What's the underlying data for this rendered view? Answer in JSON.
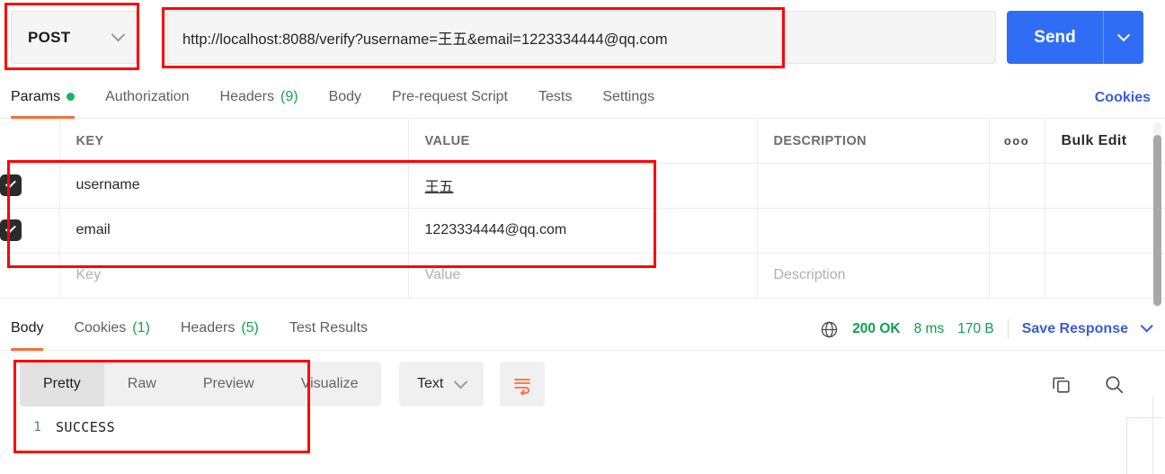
{
  "request": {
    "method": "POST",
    "method_caret_icon": "chevron-down-icon",
    "url": "http://localhost:8088/verify?username=王五&email=1223334444@qq.com",
    "send_label": "Send",
    "send_caret_icon": "chevron-down-icon"
  },
  "request_tabs": [
    {
      "label": "Params",
      "badge": "",
      "dot": true,
      "active": true
    },
    {
      "label": "Authorization",
      "badge": "",
      "dot": false,
      "active": false
    },
    {
      "label": "Headers",
      "badge": "(9)",
      "dot": false,
      "active": false
    },
    {
      "label": "Body",
      "badge": "",
      "dot": false,
      "active": false
    },
    {
      "label": "Pre-request Script",
      "badge": "",
      "dot": false,
      "active": false
    },
    {
      "label": "Tests",
      "badge": "",
      "dot": false,
      "active": false
    },
    {
      "label": "Settings",
      "badge": "",
      "dot": false,
      "active": false
    }
  ],
  "cookies_link": "Cookies",
  "params_table": {
    "headers": {
      "key": "KEY",
      "value": "VALUE",
      "description": "DESCRIPTION",
      "more_icon": "ooo",
      "bulk_edit": "Bulk Edit"
    },
    "rows": [
      {
        "checked": true,
        "key": "username",
        "value": "王五",
        "description": "",
        "value_underline": true
      },
      {
        "checked": true,
        "key": "email",
        "value": "1223334444@qq.com",
        "description": "",
        "value_underline": false
      }
    ],
    "placeholder_row": {
      "key": "Key",
      "value": "Value",
      "description": "Description"
    }
  },
  "response_tabs": [
    {
      "label": "Body",
      "badge": "",
      "active": true
    },
    {
      "label": "Cookies",
      "badge": "(1)",
      "active": false
    },
    {
      "label": "Headers",
      "badge": "(5)",
      "active": false
    },
    {
      "label": "Test Results",
      "badge": "",
      "active": false
    }
  ],
  "status": {
    "globe_icon": "globe-icon",
    "code": "200 OK",
    "time": "8 ms",
    "size": "170 B",
    "save_response": "Save Response",
    "save_caret_icon": "chevron-down-icon"
  },
  "viewer": {
    "modes": [
      {
        "label": "Pretty",
        "active": true
      },
      {
        "label": "Raw",
        "active": false
      },
      {
        "label": "Preview",
        "active": false
      },
      {
        "label": "Visualize",
        "active": false
      }
    ],
    "format": "Text",
    "format_caret_icon": "chevron-down-icon",
    "wrap_icon": "word-wrap-icon",
    "copy_icon": "copy-icon",
    "search_icon": "search-icon"
  },
  "response_body": {
    "line_number": "1",
    "content": "SUCCESS"
  },
  "colors": {
    "accent_orange": "#ff6c37",
    "brand_blue": "#2f6df4",
    "link_blue": "#3b5bdb",
    "status_green": "#0f9d4f",
    "annotation_red": "#ff0000"
  }
}
